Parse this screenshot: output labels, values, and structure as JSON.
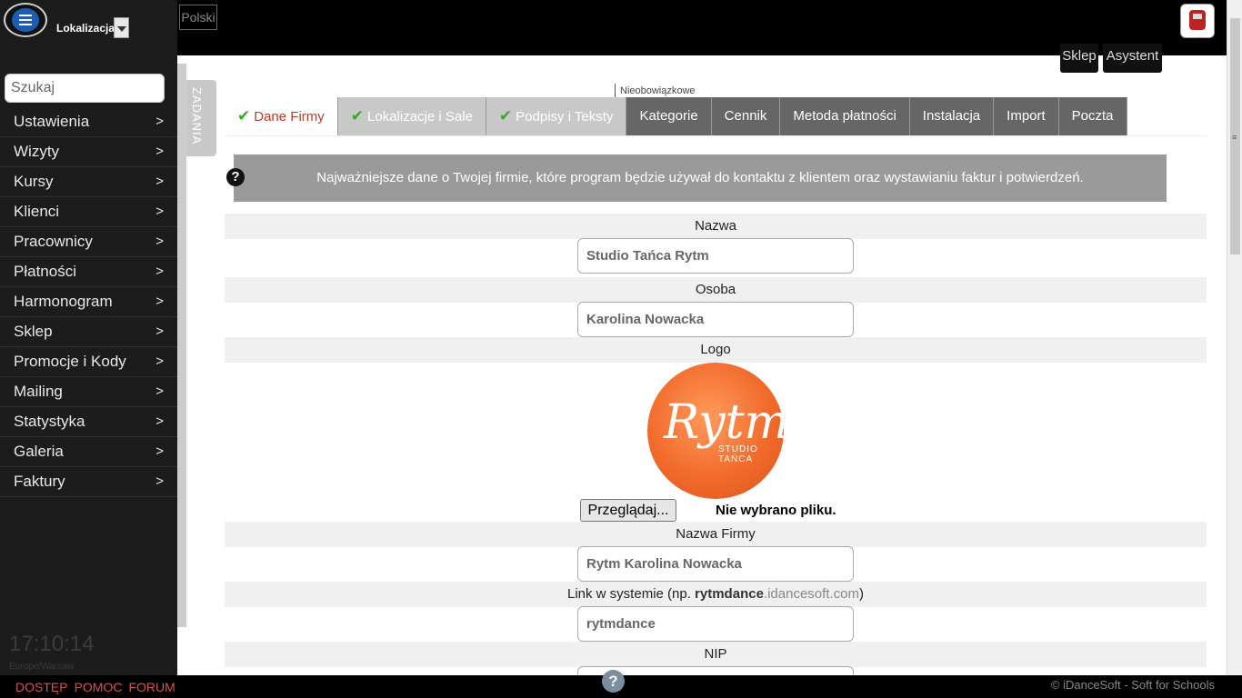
{
  "sidebar": {
    "location_label": "Lokalizacja",
    "search_placeholder": "Szukaj",
    "items": [
      {
        "label": "Ustawienia"
      },
      {
        "label": "Wizyty"
      },
      {
        "label": "Kursy"
      },
      {
        "label": "Klienci"
      },
      {
        "label": "Pracownicy"
      },
      {
        "label": "Płatności"
      },
      {
        "label": "Harmonogram"
      },
      {
        "label": "Sklep"
      },
      {
        "label": "Promocje i Kody"
      },
      {
        "label": "Mailing"
      },
      {
        "label": "Statystyka"
      },
      {
        "label": "Galeria"
      },
      {
        "label": "Faktury"
      }
    ],
    "arrow": ">",
    "clock": "17:10:14",
    "timezone": "Europe/Warsaw"
  },
  "topbar": {
    "language": "Polski",
    "shop_label": "Sklep",
    "assistant_label": "Asystent"
  },
  "zadania_label": "ZADANIA",
  "tabs": {
    "optional_label": "Nieobowiązkowe",
    "items": [
      {
        "label": "Dane Firmy",
        "state": "active"
      },
      {
        "label": "Lokalizacje i Sale",
        "state": "done"
      },
      {
        "label": "Podpisy i Teksty",
        "state": "done"
      },
      {
        "label": "Kategorie",
        "state": "optional"
      },
      {
        "label": "Cennik",
        "state": "optional"
      },
      {
        "label": "Metoda płatności",
        "state": "optional"
      },
      {
        "label": "Instalacja",
        "state": "optional"
      },
      {
        "label": "Import",
        "state": "optional"
      },
      {
        "label": "Poczta",
        "state": "optional"
      }
    ]
  },
  "info_text": "Najważniejsze dane o Twojej firmie, które program będzie używał do kontaktu z klientem oraz wystawianiu faktur i potwierdzeń.",
  "form": {
    "name_label": "Nazwa",
    "name_value": "Studio Tańca Rytm",
    "person_label": "Osoba",
    "person_value": "Karolina Nowacka",
    "logo_label": "Logo",
    "logo_text": "Rytm",
    "logo_subtext": "STUDIO TAŃCA",
    "browse_label": "Przeglądaj...",
    "no_file": "Nie wybrano pliku.",
    "company_label": "Nazwa Firmy",
    "company_value": "Rytm Karolina Nowacka",
    "link_label_prefix": "Link w systemie (np. ",
    "link_label_bold": "rytmdance",
    "link_label_domain": ".idancesoft.com",
    "link_label_suffix": ")",
    "link_value": "rytmdance",
    "nip_label": "NIP"
  },
  "bottom": {
    "links": [
      "DOSTĘP",
      "POMOC",
      "FORUM"
    ],
    "help": "?",
    "copyright": "© iDanceSoft - Soft for Schools"
  },
  "colors": {
    "active_tab_text": "#c0392b",
    "bottom_links": "#d35454",
    "menu_button": "#1a5db3",
    "check": "#3aa52a"
  }
}
